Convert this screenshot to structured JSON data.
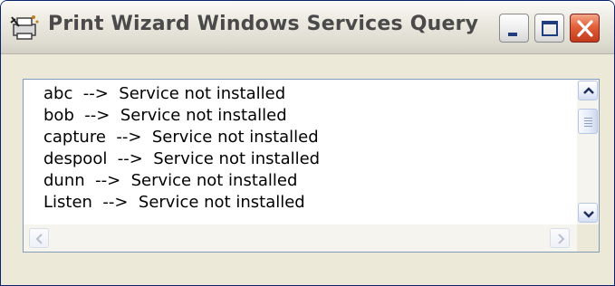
{
  "window": {
    "title": "Print Wizard Windows Services Query",
    "title_icon": "printer-wizard-icon",
    "controls": {
      "minimize_icon": "minimize-icon",
      "maximize_icon": "maximize-icon",
      "close_icon": "close-icon"
    }
  },
  "service_list": {
    "items": [
      "abc  -->  Service not installed",
      "bob  -->  Service not installed",
      "capture  -->  Service not installed",
      "despool  -->  Service not installed",
      "dunn  -->  Service not installed",
      "Listen  -->  Service not installed"
    ]
  },
  "colors": {
    "window_border": "#0a246a",
    "close_button": "#d9502f",
    "list_border": "#7f9db9",
    "face": "#ece9d8"
  }
}
